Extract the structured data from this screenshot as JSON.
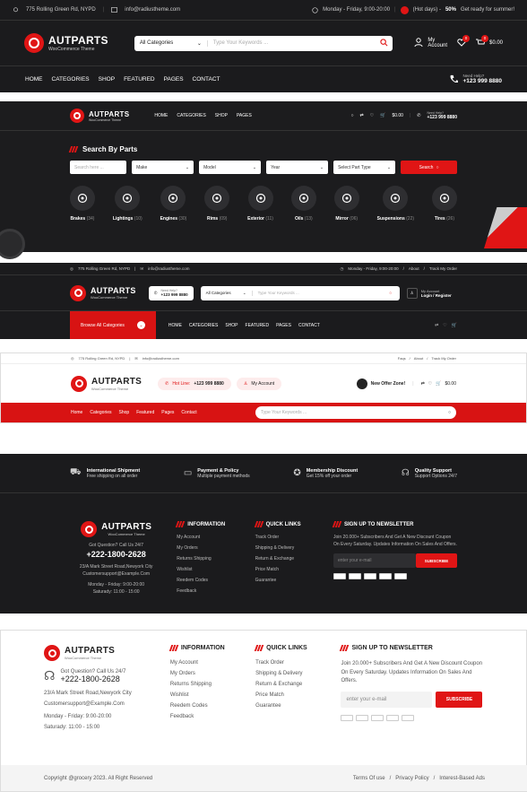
{
  "h1": {
    "address": "775 Rolling Green Rd, NYPD",
    "email": "info@radiustheme.com",
    "hours": "Monday - Friday, 9:00-20:00",
    "hot": "(Hot days) -",
    "promo": "50%",
    "promo_text": "Get ready for summer!",
    "brand": "AUTPARTS",
    "brand_sub": "WooCommerce Theme",
    "category": "All Categories",
    "placeholder": "Type Your Keywords ...",
    "account": "My Account",
    "cart_count_a": "0",
    "cart_count_b": "0",
    "total": "$0.00",
    "nav": [
      "HOME",
      "CATEGORIES",
      "SHOP",
      "FEATURED",
      "PAGES",
      "CONTACT"
    ],
    "help_label": "Need Help?",
    "phone": "+123 999 8880"
  },
  "h2": {
    "brand": "AUTPARTS",
    "brand_sub": "WooCommerce Theme",
    "nav": [
      "HOME",
      "CATEGORIES",
      "SHOP",
      "PAGES"
    ],
    "total": "$0.00",
    "help_label": "Need Help?",
    "phone": "+123 999 8880",
    "title": "Search By Parts",
    "fields": [
      "Search here ...",
      "Make",
      "Model",
      "Year",
      "Select Part Type"
    ],
    "search": "Search",
    "cats": [
      {
        "name": "Brakes",
        "count": "(34)",
        "icon": "brake-icon"
      },
      {
        "name": "Lightings",
        "count": "(10)",
        "icon": "light-icon"
      },
      {
        "name": "Engines",
        "count": "(30)",
        "icon": "engine-icon"
      },
      {
        "name": "Rims",
        "count": "(09)",
        "icon": "rim-icon"
      },
      {
        "name": "Exterior",
        "count": "(11)",
        "icon": "exterior-icon"
      },
      {
        "name": "Oils",
        "count": "(13)",
        "icon": "oil-icon"
      },
      {
        "name": "Mirror",
        "count": "(06)",
        "icon": "mirror-icon"
      },
      {
        "name": "Suspensions",
        "count": "(22)",
        "icon": "suspension-icon"
      },
      {
        "name": "Tires",
        "count": "(26)",
        "icon": "tire-icon"
      }
    ]
  },
  "h3": {
    "address": "775 Rolling Green Rd, NYPD",
    "email": "info@radiustheme.com",
    "hours": "Monday - Friday, 9:00-20:00",
    "about": "About",
    "track": "Track My Order",
    "brand": "AUTPARTS",
    "brand_sub": "WooCommerce Theme",
    "help_label": "Need Help?",
    "phone": "+123 999 8880",
    "category": "All Categories",
    "placeholder": "Type Your Keywords ...",
    "account_label": "My Account",
    "account": "Login / Register",
    "browse": "Browse All Categories",
    "nav": [
      "HOME",
      "CATEGORIES",
      "SHOP",
      "FEATURED",
      "PAGES",
      "CONTACT"
    ]
  },
  "h4": {
    "address": "775 Rolling Green Rd, NYPD",
    "email": "info@radiustheme.com",
    "faqs": "Faqs",
    "about": "About",
    "track": "Track My Order",
    "brand": "AUTPARTS",
    "brand_sub": "WooCommerce Theme",
    "hotline_label": "Hot Line:",
    "phone": "+123 999 8880",
    "account": "My Account",
    "offer": "New Offer Zone!",
    "total": "$0.00",
    "nav": [
      "Home",
      "Categories",
      "Shop",
      "Featured",
      "Pages",
      "Contact"
    ],
    "placeholder": "Type Your Keywords ..."
  },
  "f1": {
    "features": [
      {
        "t": "International Shipment",
        "s": "Free shipping on all order"
      },
      {
        "t": "Payment & Policy",
        "s": "Multiple payment methods"
      },
      {
        "t": "Membership Discount",
        "s": "Get 15% off your order"
      },
      {
        "t": "Quality Support",
        "s": "Support Options 24/7"
      }
    ],
    "brand": "AUTPARTS",
    "brand_sub": "WooCommerce Theme",
    "question": "Got Question? Call Us 24/7",
    "phone": "+222-1800-2628",
    "addr": "23/A Mark Street Road,Newyork City",
    "mail": "Customersupport@Example.Com",
    "hours1": "Monday - Friday: 9:00-20:00",
    "hours2": "Saturady: 11:00 - 15:00",
    "info_title": "INFORMATION",
    "info": [
      "My Account",
      "My Orders",
      "Returns Shipping",
      "Wishlist",
      "Reedem Codes",
      "Feedback"
    ],
    "links_title": "QUICK LINKS",
    "links": [
      "Track Order",
      "Shipping & Delivery",
      "Return & Exchange",
      "Price Match",
      "Guarantee"
    ],
    "news_title": "SIGN UP TO NEWSLETTER",
    "news_text": "Join 20.000+ Subscribers And Get A New Discount Coupon On Every Saturday. Updates Information On Sales And Offers.",
    "email_ph": "enter your e-mail",
    "subscribe": "SUBSCRIBE"
  },
  "f2": {
    "brand": "AUTPARTS",
    "brand_sub": "WooCommerce Theme",
    "question": "Got Question? Call Us 24/7",
    "phone": "+222-1800-2628",
    "addr": "23/A Mark Street Road,Newyork City",
    "mail": "Customersupport@Example.Com",
    "hours1": "Monday - Friday: 9:00-20:00",
    "hours2": "Saturady: 11:00 - 15:00",
    "info_title": "INFORMATION",
    "info": [
      "My Account",
      "My Orders",
      "Returns Shipping",
      "Wishlist",
      "Reedem Codes",
      "Feedback"
    ],
    "links_title": "QUICK LINKS",
    "links": [
      "Track Order",
      "Shipping & Delivery",
      "Return & Exchange",
      "Price Match",
      "Guarantee"
    ],
    "news_title": "SIGN UP TO NEWSLETTER",
    "news_text": "Join 20.000+ Subscribers And Get A New Discount Coupon On Every Saturday. Updates Information On Sales And Offers.",
    "email_ph": "enter your e-mail",
    "subscribe": "SUBSCRIBE",
    "copyright": "Copyright @grocery 2023. All Right Reserved",
    "terms": "Terms Of use",
    "privacy": "Privacy Policy",
    "interest": "Interest-Based Ads"
  }
}
